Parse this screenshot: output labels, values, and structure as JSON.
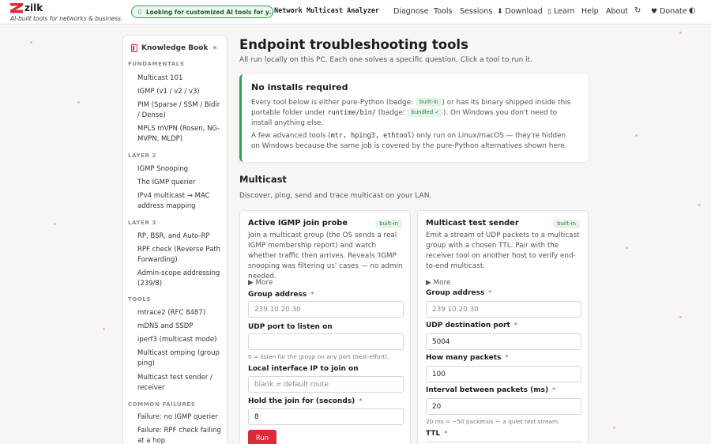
{
  "header": {
    "brand_name": "zilk",
    "brand_tagline": "AI-built tools for networks & business.",
    "promo_text": "Looking for customized AI tools for y…",
    "app_title": "Network Multicast Analyzer",
    "nav": [
      {
        "label": "Diagnose",
        "icon": ""
      },
      {
        "label": "Tools",
        "icon": ""
      },
      {
        "label": "Sessions",
        "icon": ""
      },
      {
        "label": "Download",
        "icon": "⬇"
      },
      {
        "label": "Learn",
        "icon": "▯"
      },
      {
        "label": "Help",
        "icon": ""
      },
      {
        "label": "About",
        "icon": ""
      }
    ],
    "refresh_icon": "↻",
    "donate_label": "Donate",
    "donate_icon": "♥",
    "theme_icon": "◐"
  },
  "sidebar": {
    "title": "Knowledge Book",
    "collapse_glyph": "«",
    "sections": [
      {
        "name": "FUNDAMENTALS",
        "items": [
          "Multicast 101",
          "IGMP (v1 / v2 / v3)",
          "PIM (Sparse / SSM / Bidir / Dense)",
          "MPLS mVPN (Rosen, NG-MVPN, MLDP)"
        ]
      },
      {
        "name": "LAYER 2",
        "items": [
          "IGMP Snooping",
          "The IGMP querier",
          "IPv4 multicast → MAC address mapping"
        ]
      },
      {
        "name": "LAYER 3",
        "items": [
          "RP, BSR, and Auto-RP",
          "RPF check (Reverse Path Forwarding)",
          "Admin-scope addressing (239/8)"
        ]
      },
      {
        "name": "TOOLS",
        "items": [
          "mtrace2 (RFC 8487)",
          "mDNS and SSDP",
          "iperf3 (multicast mode)",
          "Multicast omping (group ping)",
          "Multicast test sender / receiver"
        ]
      },
      {
        "name": "COMMON FAILURES",
        "items": [
          "Failure: no IGMP querier",
          "Failure: RPF check failing at a hop"
        ]
      }
    ]
  },
  "main": {
    "title": "Endpoint troubleshooting tools",
    "subtitle": "All run locally on this PC. Each one solves a specific question. Click a tool to run it.",
    "note": {
      "title": "No installs required",
      "p1_a": "Every tool below is either pure-Python (badge: ",
      "badge_builtin": "built-in",
      "p1_b": ") or has its binary shipped inside this portable folder under ",
      "p1_path": "runtime/bin/",
      "p1_c": " (badge: ",
      "badge_bundled": "bundled ✓",
      "p1_d": "). On Windows you don't need to install anything else.",
      "p2_a": "A few advanced tools (",
      "p2_tools": "mtr, hping3, ethtool",
      "p2_b": ") only run on Linux/macOS — they're hidden on Windows because the same job is covered by the pure-Python alternatives shown here."
    },
    "section_title": "Multicast",
    "section_subtitle": "Discover, ping, send and trace multicast on your LAN.",
    "cards": [
      {
        "title": "Active IGMP join probe",
        "badge": "built-in",
        "description": "Join a multicast group (the OS sends a real IGMP membership report) and watch whether traffic then arrives. Reveals 'IGMP snooping was filtering us' cases — no admin needed.",
        "more_label": "▶ More",
        "fields": [
          {
            "label": "Group address",
            "required": "*",
            "value": "",
            "placeholder": "239.10.20.30",
            "help": ""
          },
          {
            "label": "UDP port to listen on",
            "required": "",
            "value": "",
            "placeholder": "",
            "help": "0 = listen for the group on any port (best-effort)."
          },
          {
            "label": "Local interface IP to join on",
            "required": "",
            "value": "",
            "placeholder": "blank = default route",
            "help": ""
          },
          {
            "label": "Hold the join for (seconds)",
            "required": "*",
            "value": "8",
            "placeholder": "",
            "help": ""
          }
        ],
        "run_label": "Run"
      },
      {
        "title": "Multicast test sender",
        "badge": "built-in",
        "description": "Emit a stream of UDP packets to a multicast group with a chosen TTL. Pair with the receiver tool on another host to verify end-to-end multicast.",
        "more_label": "▶ More",
        "fields": [
          {
            "label": "Group address",
            "required": "*",
            "value": "",
            "placeholder": "239.10.20.30",
            "help": ""
          },
          {
            "label": "UDP destination port",
            "required": "*",
            "value": "5004",
            "placeholder": "",
            "help": ""
          },
          {
            "label": "How many packets",
            "required": "*",
            "value": "100",
            "placeholder": "",
            "help": ""
          },
          {
            "label": "Interval between packets (ms)",
            "required": "*",
            "value": "20",
            "placeholder": "",
            "help": "20 ms = ~50 packets/s — a quiet test stream."
          },
          {
            "label": "TTL",
            "required": "*",
            "value": "",
            "placeholder": "",
            "help": ""
          }
        ]
      }
    ]
  },
  "colors": {
    "accent": "#d92b3a",
    "success": "#3a9a57",
    "badge_bg": "#e7f4ea",
    "badge_text": "#2d7a45"
  }
}
